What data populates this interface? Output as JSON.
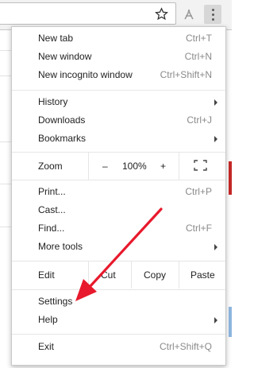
{
  "menu": {
    "items_top": [
      {
        "label": "New tab",
        "shortcut": "Ctrl+T"
      },
      {
        "label": "New window",
        "shortcut": "Ctrl+N"
      },
      {
        "label": "New incognito window",
        "shortcut": "Ctrl+Shift+N"
      }
    ],
    "items_mid": [
      {
        "label": "History",
        "shortcut": ""
      },
      {
        "label": "Downloads",
        "shortcut": "Ctrl+J"
      },
      {
        "label": "Bookmarks",
        "shortcut": ""
      }
    ],
    "zoom": {
      "label": "Zoom",
      "minus": "–",
      "value": "100%",
      "plus": "+"
    },
    "items_tools": [
      {
        "label": "Print...",
        "shortcut": "Ctrl+P"
      },
      {
        "label": "Cast...",
        "shortcut": ""
      },
      {
        "label": "Find...",
        "shortcut": "Ctrl+F"
      },
      {
        "label": "More tools",
        "shortcut": ""
      }
    ],
    "edit": {
      "label": "Edit",
      "cut": "Cut",
      "copy": "Copy",
      "paste": "Paste"
    },
    "items_bottom": [
      {
        "label": "Settings",
        "shortcut": ""
      },
      {
        "label": "Help",
        "shortcut": ""
      }
    ],
    "exit": {
      "label": "Exit",
      "shortcut": "Ctrl+Shift+Q"
    }
  },
  "colors": {
    "annotation_arrow": "#e8192c",
    "menu_border": "#cacaca",
    "shortcut_text": "#8a8a8a"
  },
  "icons": {
    "bookmark": "star-icon",
    "extension": "pdf-extension-icon",
    "menu": "kebab-menu-icon",
    "fullscreen": "fullscreen-icon"
  }
}
